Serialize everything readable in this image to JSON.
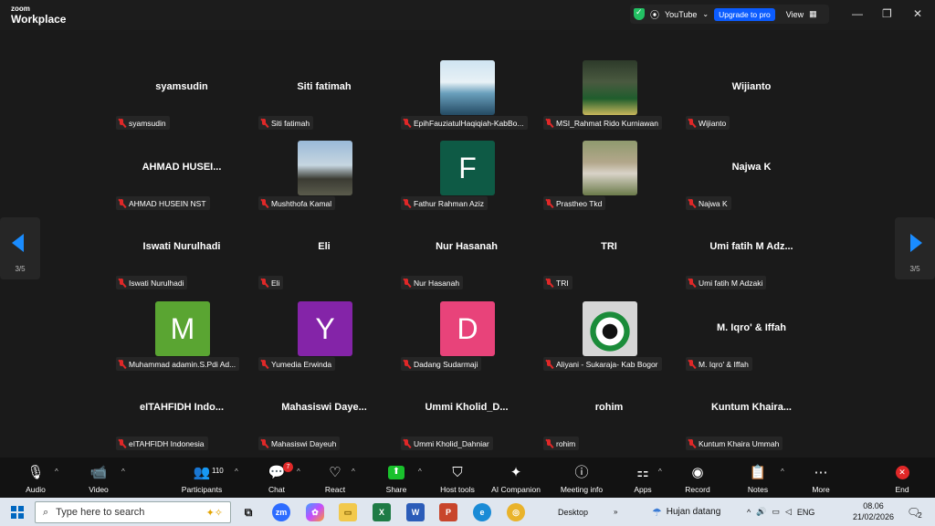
{
  "app": {
    "logo_line1": "zoom",
    "logo_line2": "Workplace"
  },
  "titlebar": {
    "stream_label": "YouTube",
    "upgrade_label": "Upgrade to pro",
    "view_label": "View"
  },
  "pager": {
    "left_page": "3/5",
    "right_page": "3/5"
  },
  "tiles": [
    {
      "big": "syamsudin",
      "label": "syamsudin"
    },
    {
      "big": "Siti fatimah",
      "label": "Siti fatimah"
    },
    {
      "image": "quote-photo",
      "label": "EpihFauziatulHaqiqiah-KabBo..."
    },
    {
      "image": "graduation-photo",
      "label": "MSI_Rahmat Rido Kurniawan"
    },
    {
      "big": "Wijianto",
      "label": "Wijianto"
    },
    {
      "big": "AHMAD  HUSEI...",
      "label": "AHMAD HUSEIN NST"
    },
    {
      "image": "person-photo",
      "label": "Mushthofa Kamal"
    },
    {
      "letter": "F",
      "color": "#0e5a45",
      "label": "Fathur Rahman Aziz"
    },
    {
      "image": "group-photo",
      "label": "Prastheo Tkd"
    },
    {
      "big": "Najwa K",
      "label": "Najwa K"
    },
    {
      "big": "Iswati Nurulhadi",
      "label": "Iswati Nurulhadi"
    },
    {
      "big": "Eli",
      "label": "Eli"
    },
    {
      "big": "Nur Hasanah",
      "label": "Nur Hasanah"
    },
    {
      "big": "TRI",
      "label": "TRI"
    },
    {
      "big": "Umi fatih M Adz...",
      "label": "Umi fatih M Adzaki"
    },
    {
      "letter": "M",
      "color": "#5aa532",
      "label": "Muhammad adamin.S.Pdi Ad..."
    },
    {
      "letter": "Y",
      "color": "#8424a8",
      "label": "Yumedia Erwinda"
    },
    {
      "letter": "D",
      "color": "#e8437a",
      "label": "Dadang Sudarmaji"
    },
    {
      "image": "palestine-heart-photo",
      "label": "Aliyani - Sukaraja- Kab Bogor"
    },
    {
      "big": "M. Iqro' & Iffah",
      "label": "M. Iqro' & Iffah"
    },
    {
      "big": "eITAHFIDH  Indo...",
      "label": "eITAHFIDH Indonesia"
    },
    {
      "big": "Mahasiswi  Daye...",
      "label": "Mahasiswi Dayeuh"
    },
    {
      "big": "Ummi  Kholid_D...",
      "label": "Ummi Kholid_Dahniar"
    },
    {
      "big": "rohim",
      "label": "rohim"
    },
    {
      "big": "Kuntum  Khaira...",
      "label": "Kuntum Khaira Ummah"
    }
  ],
  "toolbar": {
    "audio": "Audio",
    "video": "Video",
    "participants": "Participants",
    "participant_count": "110",
    "chat": "Chat",
    "chat_badge": "7",
    "react": "React",
    "share": "Share",
    "host_tools": "Host tools",
    "ai_companion": "AI Companion",
    "meeting_info": "Meeting info",
    "apps": "Apps",
    "record": "Record",
    "notes": "Notes",
    "more": "More",
    "end": "End"
  },
  "taskbar": {
    "search_placeholder": "Type here to search",
    "desktop": "Desktop",
    "weather": "Hujan datang",
    "lang": "ENG",
    "time": "08.06",
    "date": "21/02/2026",
    "notif_count": "2"
  }
}
